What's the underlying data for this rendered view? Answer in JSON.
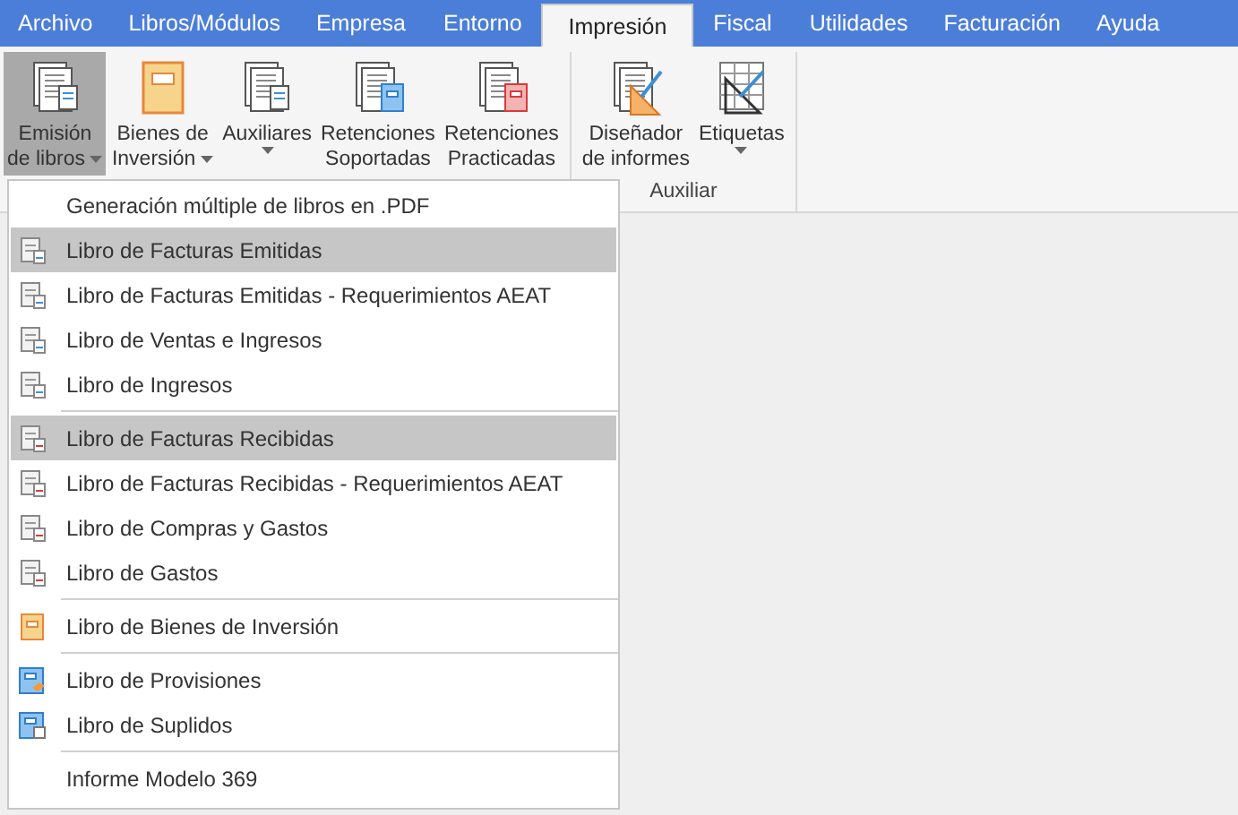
{
  "tabs": [
    {
      "label": "Archivo",
      "selected": false
    },
    {
      "label": "Libros/Módulos",
      "selected": false
    },
    {
      "label": "Empresa",
      "selected": false
    },
    {
      "label": "Entorno",
      "selected": false
    },
    {
      "label": "Impresión",
      "selected": true
    },
    {
      "label": "Fiscal",
      "selected": false
    },
    {
      "label": "Utilidades",
      "selected": false
    },
    {
      "label": "Facturación",
      "selected": false
    },
    {
      "label": "Ayuda",
      "selected": false
    }
  ],
  "ribbon": {
    "groups": [
      {
        "buttons": [
          {
            "kind": "pages",
            "lines": [
              "Emisión",
              "de libros"
            ],
            "dropdown": true,
            "selected": true
          },
          {
            "kind": "book",
            "lines": [
              "Bienes de",
              "Inversión"
            ],
            "dropdown": true,
            "selected": false
          },
          {
            "kind": "pages",
            "lines": [
              "Auxiliares"
            ],
            "dropdown": true,
            "selected": false
          },
          {
            "kind": "retained-in",
            "lines": [
              "Retenciones",
              "Soportadas"
            ],
            "dropdown": false,
            "selected": false
          },
          {
            "kind": "retained-out",
            "lines": [
              "Retenciones",
              "Practicadas"
            ],
            "dropdown": false,
            "selected": false
          }
        ]
      },
      {
        "label": "Auxiliar",
        "buttons": [
          {
            "kind": "designer",
            "lines": [
              "Diseñador",
              "de informes"
            ],
            "dropdown": false,
            "selected": false
          },
          {
            "kind": "labels",
            "lines": [
              "Etiquetas"
            ],
            "dropdown": true,
            "selected": false
          }
        ]
      }
    ]
  },
  "menu": {
    "groups": [
      {
        "items": [
          {
            "kind": "plain",
            "label": "Generación múltiple de libros en .PDF",
            "selected": false
          },
          {
            "kind": "issued",
            "label": "Libro de Facturas Emitidas",
            "selected": true
          },
          {
            "kind": "issued",
            "label": "Libro de Facturas Emitidas - Requerimientos AEAT",
            "selected": false
          },
          {
            "kind": "issued",
            "label": "Libro de Ventas e Ingresos",
            "selected": false
          },
          {
            "kind": "issued",
            "label": "Libro de Ingresos",
            "selected": false
          }
        ]
      },
      {
        "items": [
          {
            "kind": "received",
            "label": "Libro de Facturas Recibidas",
            "selected": true
          },
          {
            "kind": "received",
            "label": "Libro de Facturas Recibidas - Requerimientos AEAT",
            "selected": false
          },
          {
            "kind": "received",
            "label": "Libro de Compras y Gastos",
            "selected": false
          },
          {
            "kind": "received",
            "label": "Libro de Gastos",
            "selected": false
          }
        ]
      },
      {
        "items": [
          {
            "kind": "asset",
            "label": "Libro de Bienes de Inversión",
            "selected": false
          }
        ]
      },
      {
        "items": [
          {
            "kind": "provision",
            "label": "Libro de Provisiones",
            "selected": false
          },
          {
            "kind": "supplied",
            "label": "Libro de Suplidos",
            "selected": false
          }
        ]
      },
      {
        "items": [
          {
            "kind": "plain",
            "label": "Informe Modelo 369",
            "selected": false
          }
        ]
      }
    ]
  }
}
